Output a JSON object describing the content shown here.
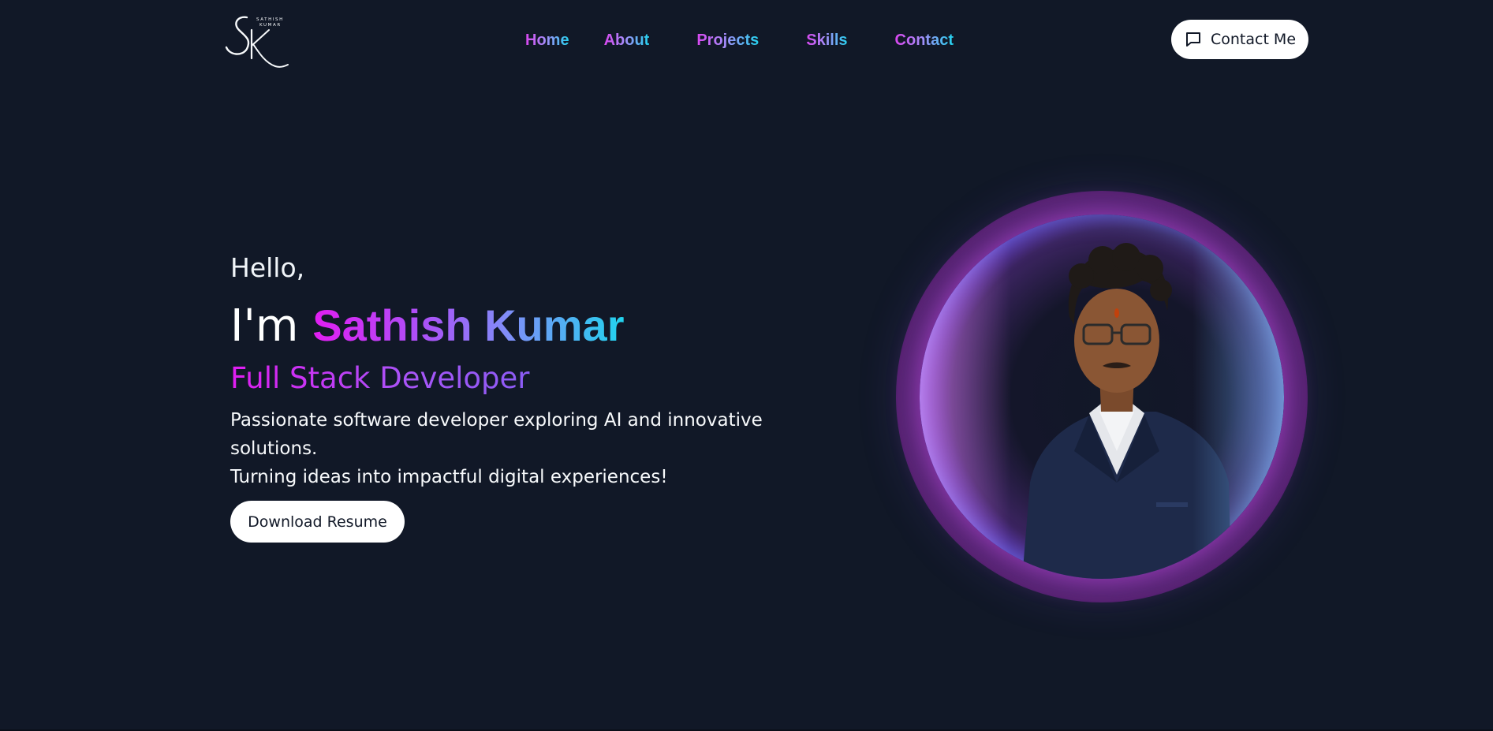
{
  "header": {
    "logo_initials": "SK",
    "logo_text": "SATHISH KUMAR",
    "nav": [
      {
        "label": "Home"
      },
      {
        "label": "About"
      },
      {
        "label": "Projects"
      },
      {
        "label": "Skills"
      },
      {
        "label": "Contact"
      }
    ],
    "contact_button": {
      "label": "Contact Me",
      "icon": "message-square-icon"
    }
  },
  "hero": {
    "greeting": "Hello,",
    "intro_prefix": "I'm",
    "name": "Sathish Kumar",
    "role": "Full Stack Developer",
    "description_line1": "Passionate software developer exploring AI and innovative solutions.",
    "description_line2": "Turning ideas into impactful digital experiences!",
    "resume_button": "Download Resume"
  },
  "colors": {
    "background": "#111827",
    "accent_pink": "#d946ef",
    "accent_purple": "#a855f7",
    "accent_cyan": "#22d3ee",
    "button_bg": "#ffffff",
    "button_text": "#111827"
  }
}
